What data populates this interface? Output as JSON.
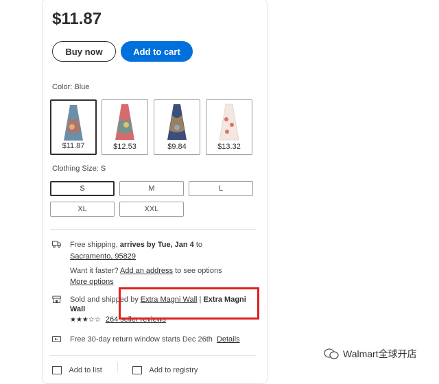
{
  "product": {
    "price": "$11.87"
  },
  "actions": {
    "buy_now": "Buy now",
    "add_to_cart": "Add to cart"
  },
  "color": {
    "label": "Color: Blue",
    "swatches": [
      {
        "price": "$11.87",
        "selected": true,
        "dress_color": "#6a8fa8",
        "accent": "#c9695a"
      },
      {
        "price": "$12.53",
        "selected": false,
        "dress_color": "#d86a6e",
        "accent": "#4ea39a"
      },
      {
        "price": "$9.84",
        "selected": false,
        "dress_color": "#3e4e7a",
        "accent": "#d7a24e"
      },
      {
        "price": "$13.32",
        "selected": false,
        "dress_color": "#f3e7e0",
        "accent": "#d4746e"
      }
    ]
  },
  "size": {
    "label": "Clothing Size: S",
    "options": [
      "S",
      "M",
      "L",
      "XL",
      "XXL"
    ],
    "selected": "S"
  },
  "shipping": {
    "prefix": "Free shipping,",
    "arrives": "arrives by Tue, Jan 4",
    "to": "to",
    "location": "Sacramento, 95829",
    "want_faster": "Want it faster?",
    "add_address": "Add an address",
    "see_options": "to see options",
    "more_options": "More options"
  },
  "seller": {
    "sold_by": "Sold and shipped by",
    "seller_link": "Extra Magni Wall",
    "separator": "|",
    "seller_name_line1": "Extra Magni",
    "seller_name_line2": "Wall",
    "stars": "★★★☆☆",
    "reviews": "264 seller reviews"
  },
  "returns": {
    "text": "Free 30-day return window starts Dec 26th",
    "details": "Details"
  },
  "footer": {
    "add_to_list": "Add to list",
    "add_to_registry": "Add to registry"
  },
  "watermark": {
    "text": "Walmart全球开店"
  },
  "colors": {
    "brand_blue": "#0071dc",
    "highlight_red": "#e0201c"
  }
}
